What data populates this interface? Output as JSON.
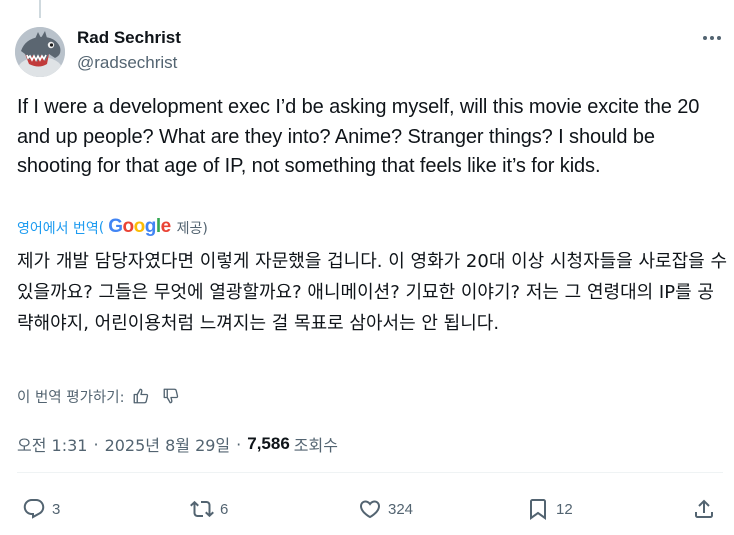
{
  "author": {
    "display_name": "Rad Sechrist",
    "handle": "@radsechrist"
  },
  "tweet": {
    "text": "If I were a development exec I’d be asking myself, will this movie excite the 20 and up people? What are they into? Anime? Stranger things? I should be shooting for that age of IP, not something that feels like it’s for kids."
  },
  "translation": {
    "link_label": "영어에서 번역",
    "open_paren": "(",
    "provider": "Google",
    "suffix": "제공)",
    "text": "제가 개발 담당자였다면 이렇게 자문했을 겁니다. 이 영화가 20대 이상 시청자들을 사로잡을 수 있을까요? 그들은 무엇에 열광할까요? 애니메이션? 기묘한 이야기? 저는 그 연령대의 IP를 공략해야지, 어린이용처럼 느껴지는 걸 목표로 삼아서는 안 됩니다.",
    "rate_label": "이 번역 평가하기:",
    "icons": [
      "thumbs-up-icon",
      "thumbs-down-icon"
    ]
  },
  "meta": {
    "time": "오전 1:31",
    "date": "2025년 8월 29일",
    "separator": "·",
    "views_count": "7,586",
    "views_label": "조회수"
  },
  "actions": {
    "replies": "3",
    "reposts": "6",
    "likes": "324",
    "bookmarks": "12",
    "icons": [
      "reply-icon",
      "repost-icon",
      "like-icon",
      "bookmark-icon",
      "share-icon"
    ]
  },
  "colors": {
    "text": "#0f1419",
    "secondary": "#536471",
    "link": "#1d9bf0",
    "divider": "#eff3f4",
    "google_blue": "#4285f4",
    "google_red": "#ea4335",
    "google_yellow": "#fbbc05",
    "google_green": "#34a853"
  }
}
